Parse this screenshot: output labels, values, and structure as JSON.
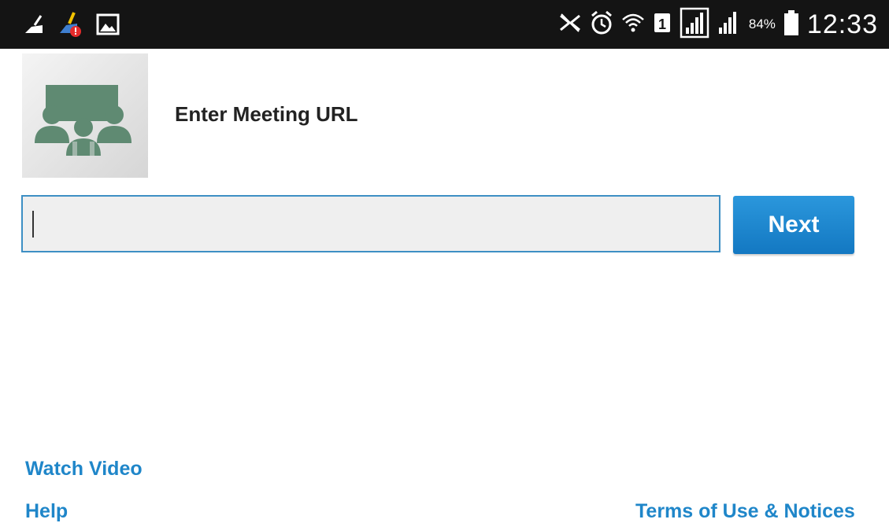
{
  "status_bar": {
    "left_icons": [
      "broom-cleaner-icon",
      "cleaner-alert-icon",
      "gallery-image-icon"
    ],
    "right_icons": [
      "nfc-muted-icon",
      "alarm-clock-icon",
      "wifi-icon",
      "sim-1-icon",
      "signal-strength-icon",
      "signal-strength-2-icon",
      "battery-icon"
    ],
    "battery_percent": "84%",
    "time": "12:33"
  },
  "app": {
    "icon": "meeting-room-icon",
    "title": "Enter Meeting URL"
  },
  "form": {
    "url_value": "",
    "url_placeholder": "",
    "next_label": "Next"
  },
  "footer": {
    "watch_video": "Watch Video",
    "help": "Help",
    "terms": "Terms of Use & Notices"
  },
  "colors": {
    "status_bar_bg": "#141414",
    "accent_blue": "#1f86c9",
    "button_blue": "#1a86d0",
    "icon_green": "#5f8a72"
  }
}
